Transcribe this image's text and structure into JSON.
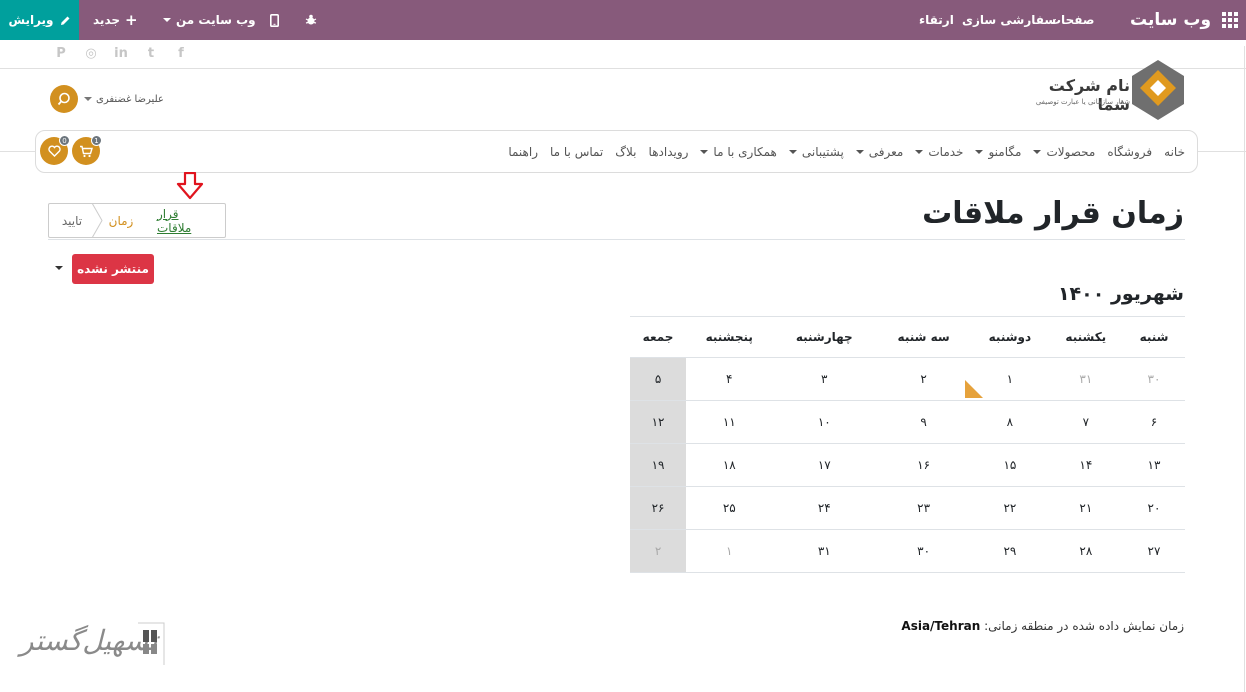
{
  "topbar": {
    "app_title": "وب سایت",
    "menu": [
      "صفحات",
      "سفارشی سازی",
      "ارتقاء"
    ],
    "my_website": "وب سایت من",
    "new_label": "جدید",
    "edit_label": "ویرایش"
  },
  "social": [
    "pinterest-icon",
    "instagram-icon",
    "linkedin-icon",
    "twitter-icon",
    "facebook-icon"
  ],
  "logo": {
    "name": "نام شرکت شما",
    "tagline": "شعار سازمانی یا عبارت توصیفی"
  },
  "user": {
    "name": "علیرضا غضنفری"
  },
  "nav": {
    "items": [
      {
        "label": "خانه",
        "dropdown": false
      },
      {
        "label": "فروشگاه",
        "dropdown": false
      },
      {
        "label": "محصولات",
        "dropdown": true
      },
      {
        "label": "مگامنو",
        "dropdown": true
      },
      {
        "label": "خدمات",
        "dropdown": true
      },
      {
        "label": "معرفی",
        "dropdown": true
      },
      {
        "label": "پشتیبانی",
        "dropdown": true
      },
      {
        "label": "همکاری با ما",
        "dropdown": true
      },
      {
        "label": "رویدادها",
        "dropdown": false
      },
      {
        "label": "بلاگ",
        "dropdown": false
      },
      {
        "label": "تماس با ما",
        "dropdown": false
      },
      {
        "label": "راهنما",
        "dropdown": false
      }
    ],
    "cart_count": "1",
    "wishlist_count": "0"
  },
  "wizard": {
    "step1": "قرار ملاقات",
    "step2": "زمان",
    "step3": "تایید"
  },
  "page": {
    "title": "زمان قرار ملاقات",
    "publish_label": "منتشر نشده"
  },
  "calendar": {
    "month": "شهریور ۱۴۰۰",
    "weekdays": [
      "شنبه",
      "یکشنبه",
      "دوشنبه",
      "سه شنبه",
      "چهارشنبه",
      "پنجشنبه",
      "جمعه"
    ],
    "weeks": [
      [
        "۳۰",
        "۳۱",
        "۱",
        "۲",
        "۳",
        "۴",
        "۵"
      ],
      [
        "۶",
        "۷",
        "۸",
        "۹",
        "۱۰",
        "۱۱",
        "۱۲"
      ],
      [
        "۱۳",
        "۱۴",
        "۱۵",
        "۱۶",
        "۱۷",
        "۱۸",
        "۱۹"
      ],
      [
        "۲۰",
        "۲۱",
        "۲۲",
        "۲۳",
        "۲۴",
        "۲۵",
        "۲۶"
      ],
      [
        "۲۷",
        "۲۸",
        "۲۹",
        "۳۰",
        "۳۱",
        "۱",
        "۲"
      ]
    ],
    "muted": [
      [
        0,
        0
      ],
      [
        0,
        1
      ],
      [
        4,
        5
      ],
      [
        4,
        6
      ]
    ]
  },
  "timezone": {
    "label": "زمان نمایش داده شده در منطقه زمانی:",
    "value": "Asia/Tehran"
  },
  "watermark": {
    "text": "تسهیل‌گستر"
  },
  "colors": {
    "topbar": "#875a7b",
    "edit": "#00a09d",
    "accent": "#d2901f",
    "danger": "#dc3545"
  }
}
